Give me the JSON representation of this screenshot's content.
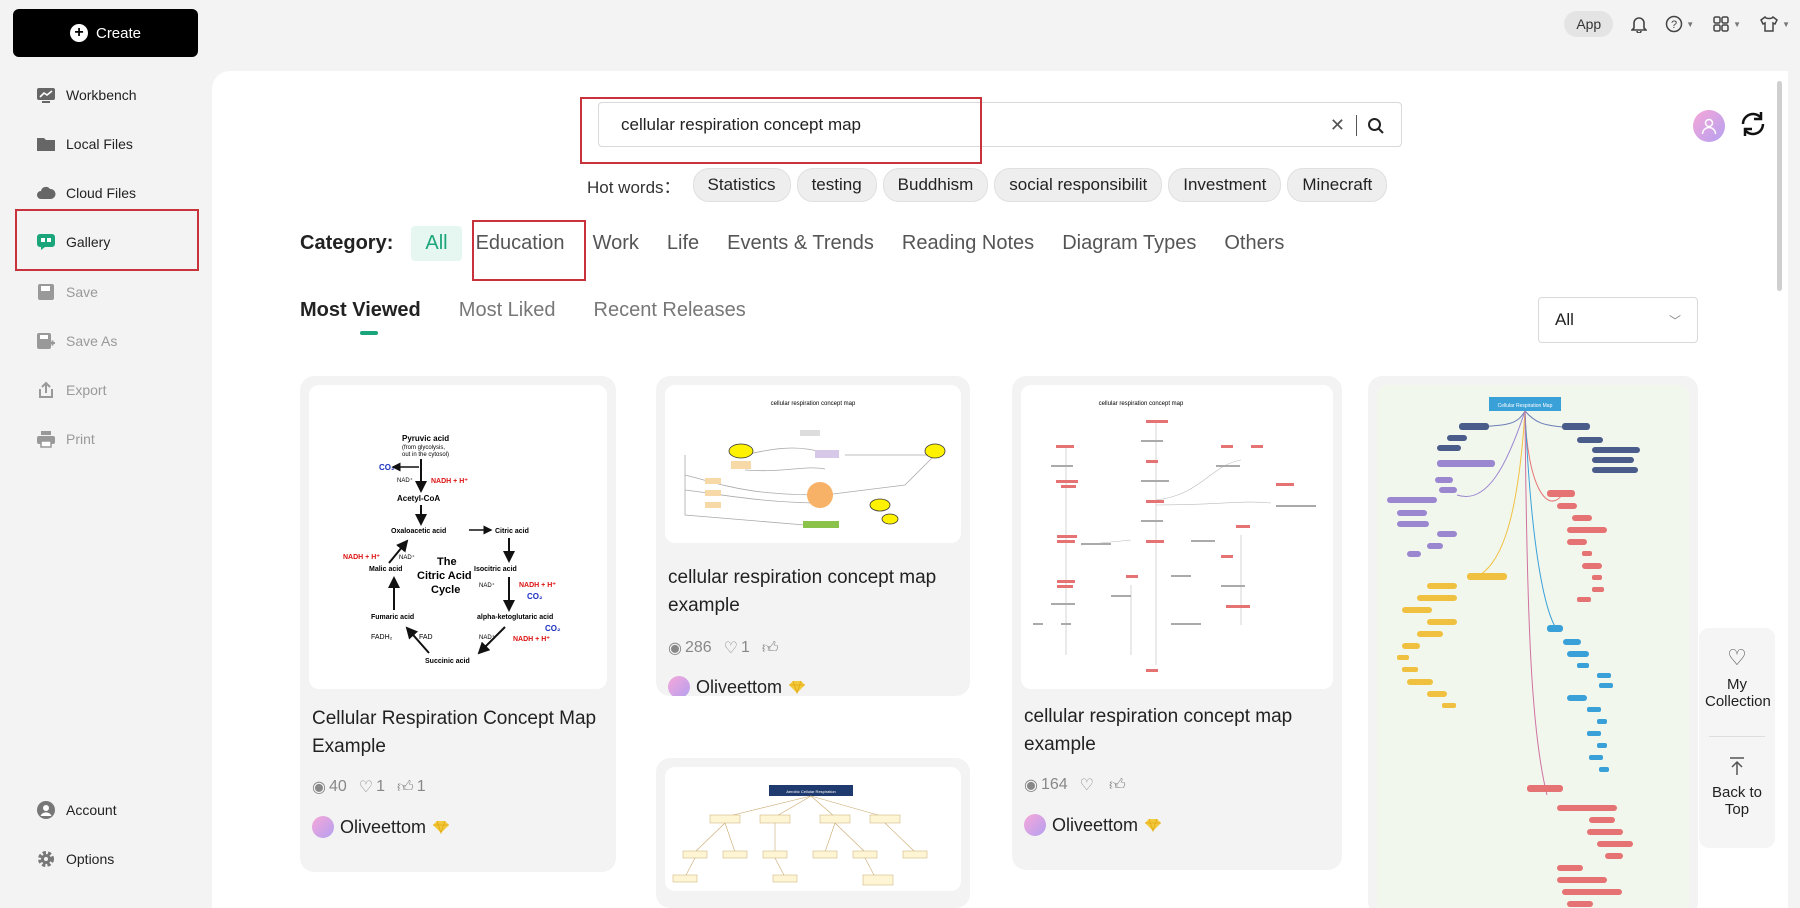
{
  "sidebar": {
    "create_label": "Create",
    "items": [
      {
        "label": "Workbench",
        "icon": "workbench-icon"
      },
      {
        "label": "Local Files",
        "icon": "folder-icon"
      },
      {
        "label": "Cloud Files",
        "icon": "cloud-icon"
      },
      {
        "label": "Gallery",
        "icon": "gallery-icon"
      },
      {
        "label": "Save",
        "icon": "save-icon"
      },
      {
        "label": "Save As",
        "icon": "save-as-icon"
      },
      {
        "label": "Export",
        "icon": "export-icon"
      },
      {
        "label": "Print",
        "icon": "print-icon"
      }
    ],
    "bottom": [
      {
        "label": "Account",
        "icon": "account-icon"
      },
      {
        "label": "Options",
        "icon": "gear-icon"
      }
    ]
  },
  "topbar": {
    "app_label": "App"
  },
  "search": {
    "value": "cellular respiration concept map",
    "hot_label": "Hot words：",
    "hot_words": [
      "Statistics",
      "testing",
      "Buddhism",
      "social responsibilit",
      "Investment",
      "Minecraft"
    ]
  },
  "category": {
    "label": "Category:",
    "items": [
      "All",
      "Education",
      "Work",
      "Life",
      "Events & Trends",
      "Reading Notes",
      "Diagram Types",
      "Others"
    ],
    "active": "All"
  },
  "sort": {
    "tabs": [
      "Most Viewed",
      "Most Liked",
      "Recent Releases"
    ],
    "active": "Most Viewed",
    "filter_value": "All"
  },
  "cards": [
    {
      "title": "Cellular Respiration Concept Map Example",
      "views": "40",
      "likes": "1",
      "thumbs": "1",
      "author": "Oliveettom",
      "thumb_labels": {
        "pyruvic": "Pyruvic acid",
        "pyruvic_note1": "(from glycolysis,",
        "pyruvic_note2": "out in the cytosol)",
        "co2": "CO₂",
        "nad": "NAD⁺",
        "nadh": "NADH + H⁺",
        "acetyl": "Acetyl-CoA",
        "oxalo": "Oxaloacetic acid",
        "citric": "Citric acid",
        "malic": "Malic acid",
        "isocitric": "Isocitric acid",
        "fumaric": "Fumaric acid",
        "alpha": "alpha-ketoglutaric acid",
        "fadh2": "FADH₂",
        "fad": "FAD",
        "succinic": "Succinic acid",
        "cycle1": "The",
        "cycle2": "Citric Acid",
        "cycle3": "Cycle"
      }
    },
    {
      "title": "cellular respiration concept map example",
      "views": "286",
      "likes": "1",
      "thumbs": "",
      "author": "Oliveettom",
      "thumb_heading": "cellular respiration concept map"
    },
    {
      "title": "cellular respiration concept map example",
      "views": "164",
      "likes": "",
      "thumbs": "",
      "author": "Oliveettom",
      "thumb_heading": "cellular respiration concept map"
    },
    {
      "thumb_heading": "Cellular Respiration Map"
    },
    {
      "thumb_heading": "Aerobic Cellular Respiration"
    }
  ],
  "float": {
    "collection_label": "My Collection",
    "top_label": "Back to Top"
  },
  "colors": {
    "accent": "#1aa67a",
    "highlight": "#c8323a"
  }
}
